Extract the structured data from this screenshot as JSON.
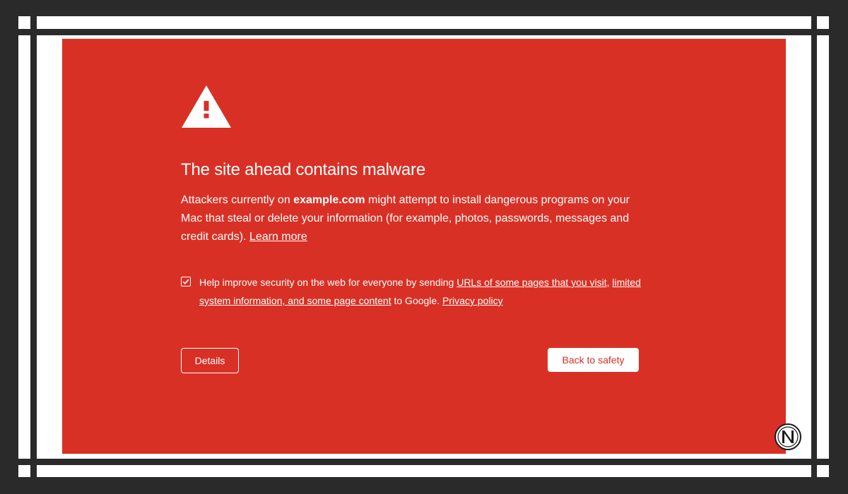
{
  "page": {
    "headline": "The site ahead contains malware",
    "description": {
      "prefix": "Attackers currently on ",
      "domain": "example.com",
      "suffix": " might attempt to install dangerous programs on your Mac that steal or delete your information (for example, photos, passwords, messages and credit cards). ",
      "learn_more": "Learn more"
    },
    "optin": {
      "checked": true,
      "prefix": "Help improve security on the web for everyone by sending ",
      "link_urls": "URLs of some pages that you visit,",
      "space": " ",
      "link_info": "limited system information, and some page content",
      "middle": " to Google. ",
      "privacy_policy": "Privacy policy"
    },
    "buttons": {
      "details": "Details",
      "back_to_safety": "Back to safety"
    }
  },
  "colors": {
    "background": "#d93025",
    "text": "#ffffff",
    "frame": "#2a2a2a"
  },
  "icons": {
    "warning": "warning-triangle-icon",
    "checkmark": "checkmark-icon",
    "logo": "n-logo-icon"
  }
}
